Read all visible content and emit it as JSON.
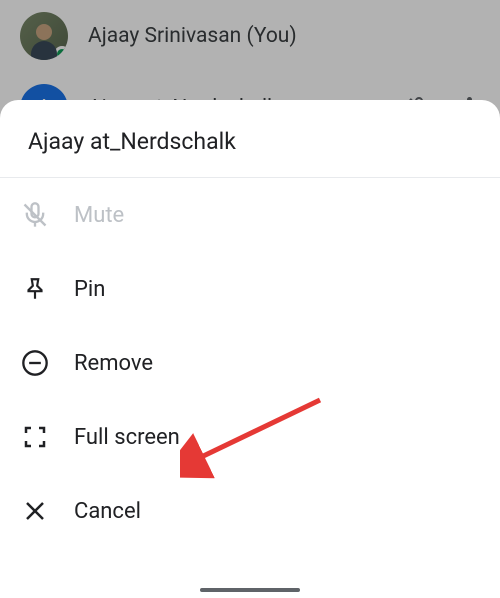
{
  "background": {
    "participant1": {
      "name": "Ajaay Srinivasan (You)",
      "initial": "",
      "online": true
    },
    "participant2": {
      "name": "Ajaay at_Nerdschalk",
      "initial": "A"
    }
  },
  "sheet": {
    "title": "Ajaay at_Nerdschalk",
    "items": {
      "mute": {
        "label": "Mute",
        "icon": "mute-icon",
        "disabled": true
      },
      "pin": {
        "label": "Pin",
        "icon": "pin-icon"
      },
      "remove": {
        "label": "Remove",
        "icon": "remove-icon"
      },
      "fullscreen": {
        "label": "Full screen",
        "icon": "fullscreen-icon"
      },
      "cancel": {
        "label": "Cancel",
        "icon": "close-icon"
      }
    }
  }
}
